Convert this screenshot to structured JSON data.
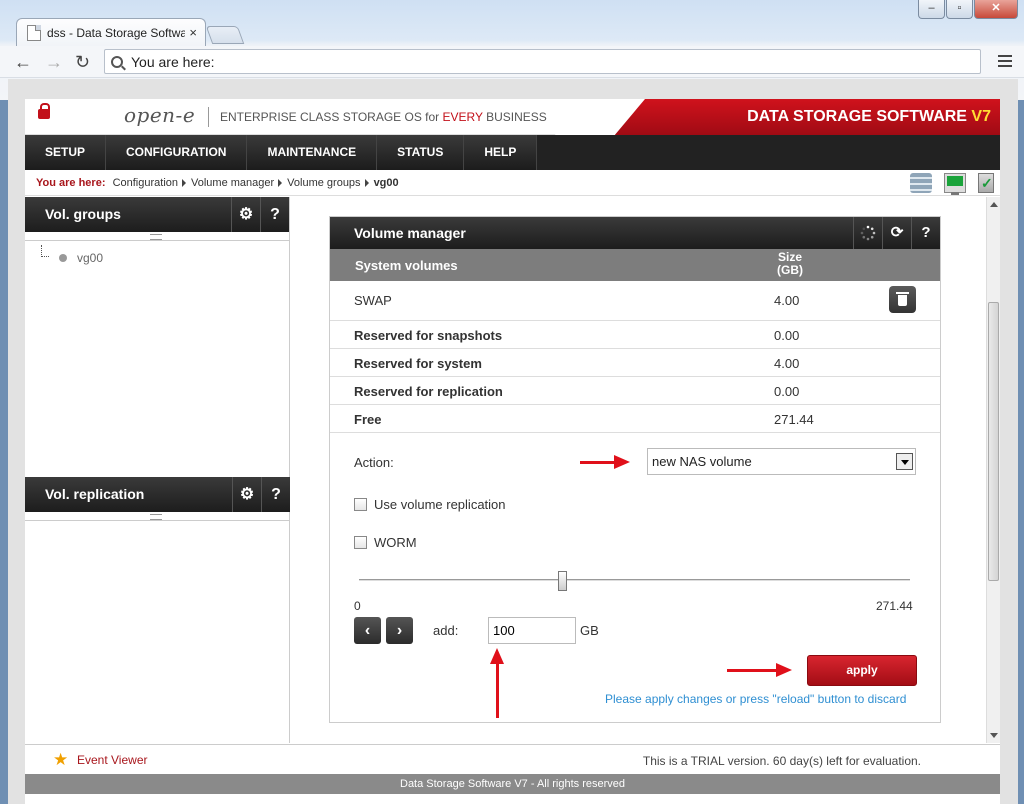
{
  "browser": {
    "tab_title": "dss - Data Storage Softwa",
    "tab_close": "×",
    "address": "You are here:",
    "window_buttons": {
      "minimize": "–",
      "maximize": "▫",
      "close": "✕"
    }
  },
  "banner": {
    "logo": "open-e",
    "tagline_prefix": "ENTERPRISE CLASS STORAGE OS for ",
    "tagline_highlight": "EVERY",
    "tagline_suffix": " BUSINESS",
    "product": "DATA STORAGE SOFTWARE ",
    "version": "V7"
  },
  "mainnav": {
    "items": [
      "SETUP",
      "CONFIGURATION",
      "MAINTENANCE",
      "STATUS",
      "HELP"
    ]
  },
  "breadcrumb": {
    "label": "You are here:",
    "items": [
      "Configuration",
      "Volume manager",
      "Volume groups",
      "vg00"
    ]
  },
  "vol_groups": {
    "title": "Vol. groups",
    "gear": "⚙",
    "help": "?",
    "items": [
      "vg00"
    ]
  },
  "vol_replication": {
    "title": "Vol. replication",
    "gear": "⚙",
    "help": "?"
  },
  "volume_manager": {
    "title": "Volume manager",
    "refresh": "⟳",
    "help": "?",
    "columns": [
      "System volumes",
      "Size\n(GB)"
    ],
    "col_size_line1": "Size",
    "col_size_line2": "(GB)",
    "rows": [
      {
        "name": "SWAP",
        "size": "4.00"
      },
      {
        "name": "Reserved for snapshots",
        "size": "0.00"
      },
      {
        "name": "Reserved for system",
        "size": "4.00"
      },
      {
        "name": "Reserved for replication",
        "size": "0.00"
      },
      {
        "name": "Free",
        "size": "271.44"
      }
    ],
    "action_label": "Action:",
    "action_value": "new NAS volume",
    "use_replication_label": "Use volume replication",
    "use_replication_checked": false,
    "worm_label": "WORM",
    "worm_checked": false,
    "slider_min": "0",
    "slider_max": "271.44",
    "slider_value": 100,
    "add_label": "add:",
    "add_value": "100",
    "unit": "GB",
    "prev": "‹",
    "next": "›",
    "apply_label": "apply",
    "hint": "Please apply changes or press \"reload\" button to discard"
  },
  "footer": {
    "event_viewer": "Event Viewer",
    "trial": "This is a TRIAL version. 60 day(s) left for evaluation.",
    "copyright": "Data Storage Software V7 - All rights reserved"
  },
  "colors": {
    "brand_red": "#c2101a",
    "link_blue": "#2f8fd2",
    "header_dark": "#222222",
    "annotation_red": "#e0101a"
  }
}
